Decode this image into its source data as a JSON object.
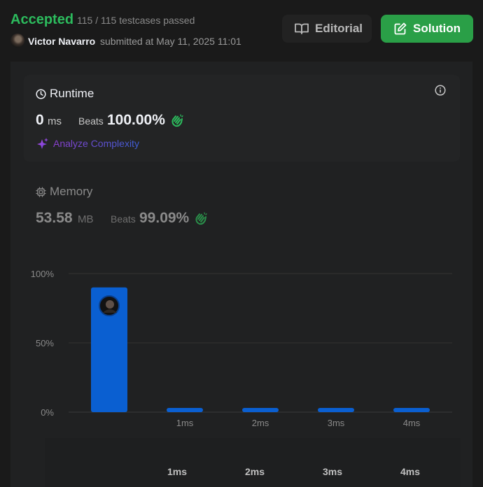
{
  "header": {
    "status": "Accepted",
    "testcases": "115 / 115 testcases passed",
    "user": "Victor Navarro",
    "submitted": "submitted at May 11, 2025 11:01",
    "editorial_label": "Editorial",
    "solution_label": "Solution"
  },
  "runtime": {
    "title": "Runtime",
    "value": "0",
    "unit": "ms",
    "beats_label": "Beats",
    "beats_value": "100.00%",
    "analyze_label": "Analyze Complexity"
  },
  "memory": {
    "title": "Memory",
    "value": "53.58",
    "unit": "MB",
    "beats_label": "Beats",
    "beats_value": "99.09%"
  },
  "bottom_ticks": [
    "1ms",
    "2ms",
    "3ms",
    "4ms"
  ],
  "colors": {
    "accepted": "#2cbb5d",
    "solution_button": "#2a9f47",
    "bar": "#0a5fd1",
    "clap": "#2cbb5d"
  },
  "icons": {
    "editorial": "book-icon",
    "solution": "edit-icon",
    "runtime": "clock-icon",
    "memory": "chip-icon",
    "info": "info-icon",
    "analyze": "sparkle-icon",
    "beats": "clap-icon"
  },
  "chart_data": {
    "type": "bar",
    "categories": [
      "",
      "1ms",
      "2ms",
      "3ms",
      "4ms"
    ],
    "values": [
      90,
      3,
      3,
      3,
      3
    ],
    "yticks": [
      "100%",
      "50%",
      "0%"
    ],
    "ylim": [
      0,
      100
    ],
    "grid": true,
    "title": "",
    "xlabel": "",
    "ylabel": ""
  }
}
